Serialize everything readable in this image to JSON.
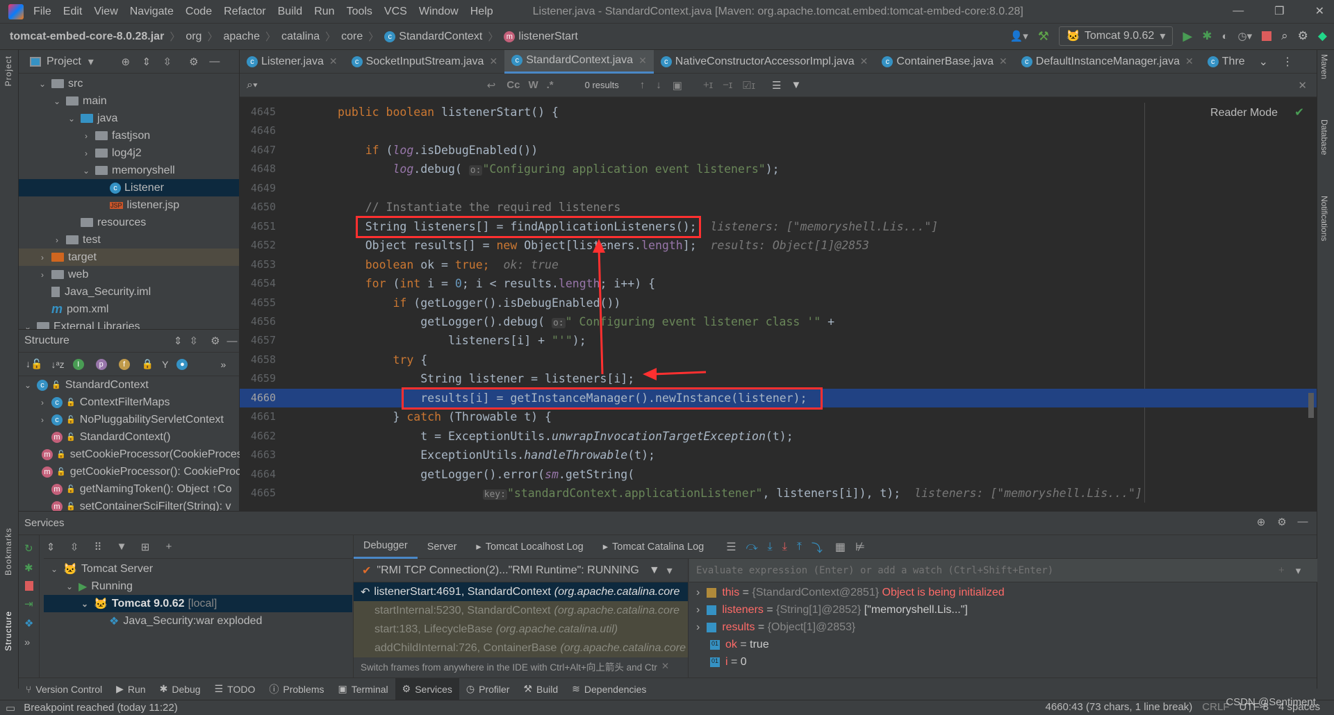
{
  "titlebar": {
    "menu": [
      "File",
      "Edit",
      "View",
      "Navigate",
      "Code",
      "Refactor",
      "Build",
      "Run",
      "Tools",
      "VCS",
      "Window",
      "Help"
    ],
    "title": "Listener.java - StandardContext.java [Maven: org.apache.tomcat.embed:tomcat-embed-core:8.0.28]"
  },
  "breadcrumb": [
    "tomcat-embed-core-8.0.28.jar",
    "org",
    "apache",
    "catalina",
    "core",
    "StandardContext",
    "listenerStart"
  ],
  "run_config": "Tomcat 9.0.62",
  "project": {
    "title": "Project",
    "tree": [
      {
        "label": "src",
        "depth": 1,
        "chev": "v",
        "icon": "folder"
      },
      {
        "label": "main",
        "depth": 2,
        "chev": "v",
        "icon": "folder"
      },
      {
        "label": "java",
        "depth": 3,
        "chev": "v",
        "icon": "source-folder"
      },
      {
        "label": "fastjson",
        "depth": 4,
        "chev": ">",
        "icon": "package"
      },
      {
        "label": "log4j2",
        "depth": 4,
        "chev": ">",
        "icon": "package"
      },
      {
        "label": "memoryshell",
        "depth": 4,
        "chev": "v",
        "icon": "package"
      },
      {
        "label": "Listener",
        "depth": 5,
        "chev": "",
        "icon": "class",
        "selected": true
      },
      {
        "label": "listener.jsp",
        "depth": 5,
        "chev": "",
        "icon": "jsp"
      },
      {
        "label": "resources",
        "depth": 3,
        "chev": "",
        "icon": "resources"
      },
      {
        "label": "test",
        "depth": 2,
        "chev": ">",
        "icon": "folder"
      },
      {
        "label": "target",
        "depth": 1,
        "chev": ">",
        "icon": "excluded-folder",
        "highlight": true
      },
      {
        "label": "web",
        "depth": 1,
        "chev": ">",
        "icon": "folder"
      },
      {
        "label": "Java_Security.iml",
        "depth": 1,
        "chev": "",
        "icon": "iml"
      },
      {
        "label": "pom.xml",
        "depth": 1,
        "chev": "",
        "icon": "maven"
      },
      {
        "label": "External Libraries",
        "depth": 0,
        "chev": "v",
        "icon": "libraries"
      }
    ]
  },
  "structure": {
    "title": "Structure",
    "items": [
      {
        "label": "StandardContext",
        "depth": 0,
        "chev": "v",
        "icon": "class"
      },
      {
        "label": "ContextFilterMaps",
        "depth": 1,
        "chev": ">",
        "icon": "class"
      },
      {
        "label": "NoPluggabilityServletContext",
        "depth": 1,
        "chev": ">",
        "icon": "class"
      },
      {
        "label": "StandardContext()",
        "depth": 1,
        "chev": "",
        "icon": "method"
      },
      {
        "label": "setCookieProcessor(CookieProcessor",
        "depth": 1,
        "chev": "",
        "icon": "method"
      },
      {
        "label": "getCookieProcessor(): CookieProcessor",
        "depth": 1,
        "chev": "",
        "icon": "method"
      },
      {
        "label": "getNamingToken(): Object ↑Co",
        "depth": 1,
        "chev": "",
        "icon": "method"
      },
      {
        "label": "setContainerSciFilter(String): v",
        "depth": 1,
        "chev": "",
        "icon": "method"
      }
    ]
  },
  "tabs": [
    {
      "label": "Listener.java"
    },
    {
      "label": "SocketInputStream.java"
    },
    {
      "label": "StandardContext.java",
      "active": true
    },
    {
      "label": "NativeConstructorAccessorImpl.java"
    },
    {
      "label": "ContainerBase.java"
    },
    {
      "label": "DefaultInstanceManager.java"
    },
    {
      "label": "Thre"
    }
  ],
  "findbar": {
    "results": "0 results",
    "options": [
      "Cc",
      "W",
      ".*"
    ]
  },
  "reader_mode": "Reader Mode",
  "current_line": 4660,
  "code": [
    {
      "n": 4645,
      "t": [
        [
          "kw",
          "public boolean "
        ],
        [
          "",
          "listenerStart() {"
        ]
      ]
    },
    {
      "n": 4646,
      "t": []
    },
    {
      "n": 4647,
      "t": [
        [
          "",
          "    "
        ],
        [
          "kw",
          "if"
        ],
        [
          "",
          " ("
        ],
        [
          "fldi",
          "log"
        ],
        [
          "",
          ".isDebugEnabled())"
        ]
      ]
    },
    {
      "n": 4648,
      "t": [
        [
          "",
          "        "
        ],
        [
          "fldi",
          "log"
        ],
        [
          "",
          ".debug( "
        ],
        [
          "hint",
          "o:"
        ],
        [
          "str",
          "\"Configuring application event listeners\""
        ],
        [
          "",
          ");"
        ]
      ]
    },
    {
      "n": 4649,
      "t": []
    },
    {
      "n": 4650,
      "t": [
        [
          "",
          "    "
        ],
        [
          "cm",
          "// Instantiate the required listeners"
        ]
      ]
    },
    {
      "n": 4651,
      "t": [
        [
          "",
          "    String listeners[] = findApplicationListeners();"
        ],
        [
          "inl",
          "  listeners: [\"memoryshell.Lis...\"]"
        ]
      ]
    },
    {
      "n": 4652,
      "t": [
        [
          "",
          "    Object results[] = "
        ],
        [
          "kw",
          "new"
        ],
        [
          "",
          " Object[listeners."
        ],
        [
          "fld",
          "length"
        ],
        [
          "",
          "];"
        ],
        [
          "inl",
          "  results: Object[1]@2853"
        ]
      ]
    },
    {
      "n": 4653,
      "t": [
        [
          "",
          "    "
        ],
        [
          "kw",
          "boolean "
        ],
        [
          "",
          "ok = "
        ],
        [
          "kw",
          "true;"
        ],
        [
          "inl",
          "  ok: true"
        ]
      ]
    },
    {
      "n": 4654,
      "t": [
        [
          "",
          "    "
        ],
        [
          "kw",
          "for"
        ],
        [
          "",
          " ("
        ],
        [
          "kw",
          "int"
        ],
        [
          "",
          " i = "
        ],
        [
          "num",
          "0"
        ],
        [
          "",
          "; i < results."
        ],
        [
          "fld",
          "length"
        ],
        [
          "",
          "; i++) {"
        ]
      ]
    },
    {
      "n": 4655,
      "t": [
        [
          "",
          "        "
        ],
        [
          "kw",
          "if"
        ],
        [
          "",
          " (getLogger().isDebugEnabled())"
        ]
      ]
    },
    {
      "n": 4656,
      "t": [
        [
          "",
          "            getLogger().debug( "
        ],
        [
          "hint",
          "o:"
        ],
        [
          "str",
          "\" Configuring event listener class '\""
        ],
        [
          "",
          " +"
        ]
      ]
    },
    {
      "n": 4657,
      "t": [
        [
          "",
          "                listeners[i] + "
        ],
        [
          "str",
          "\"'\""
        ],
        [
          "",
          ");"
        ]
      ]
    },
    {
      "n": 4658,
      "t": [
        [
          "",
          "        "
        ],
        [
          "kw",
          "try"
        ],
        [
          "",
          " {"
        ]
      ]
    },
    {
      "n": 4659,
      "t": [
        [
          "",
          "            String listener = listeners[i];"
        ]
      ]
    },
    {
      "n": 4660,
      "t": [
        [
          "",
          "            results[i] = getInstanceManager().newInstance(listener);"
        ]
      ]
    },
    {
      "n": 4661,
      "t": [
        [
          "",
          "        } "
        ],
        [
          "kw",
          "catch"
        ],
        [
          "",
          " (Throwable t) {"
        ]
      ]
    },
    {
      "n": 4662,
      "t": [
        [
          "",
          "            t = ExceptionUtils."
        ],
        [
          "it",
          "unwrapInvocationTargetException"
        ],
        [
          "",
          "(t);"
        ]
      ]
    },
    {
      "n": 4663,
      "t": [
        [
          "",
          "            ExceptionUtils."
        ],
        [
          "it",
          "handleThrowable"
        ],
        [
          "",
          "(t);"
        ]
      ]
    },
    {
      "n": 4664,
      "t": [
        [
          "",
          "            getLogger().error("
        ],
        [
          "fldi",
          "sm"
        ],
        [
          "",
          ".getString("
        ]
      ]
    },
    {
      "n": 4665,
      "t": [
        [
          "",
          "                     "
        ],
        [
          "hint",
          "key:"
        ],
        [
          "str",
          "\"standardContext.applicationListener\""
        ],
        [
          "",
          ", listeners[i]), t);"
        ],
        [
          "inl",
          "  listeners: [\"memoryshell.Lis...\"]"
        ]
      ]
    }
  ],
  "annotation_color": "#ff3030",
  "services": {
    "title": "Services",
    "tree": [
      {
        "label": "Tomcat Server",
        "depth": 0
      },
      {
        "label": "Running",
        "depth": 1
      },
      {
        "label": "Tomcat 9.0.62",
        "suffix": "[local]",
        "depth": 2,
        "selected": true
      },
      {
        "label": "Java_Security:war exploded",
        "depth": 3
      }
    ]
  },
  "debugger": {
    "tabs": [
      "Debugger",
      "Server",
      "Tomcat Localhost Log",
      "Tomcat Catalina Log"
    ],
    "thread": "\"RMI TCP Connection(2)...\"RMI Runtime\": RUNNING",
    "frames": [
      {
        "method": "listenerStart:4691, StandardContext",
        "pkg": "(org.apache.catalina.core"
      },
      {
        "method": "startInternal:5230, StandardContext",
        "pkg": "(org.apache.catalina.core"
      },
      {
        "method": "start:183, LifecycleBase",
        "pkg": "(org.apache.catalina.util)"
      },
      {
        "method": "addChildInternal:726, ContainerBase",
        "pkg": "(org.apache.catalina.core"
      }
    ],
    "frames_hint": "Switch frames from anywhere in the IDE with Ctrl+Alt+向上箭头 and Ctr",
    "eval_placeholder": "Evaluate expression (Enter) or add a watch (Ctrl+Shift+Enter)",
    "variables": [
      {
        "name": "this",
        "eq": " = ",
        "ref": "{StandardContext@2851}",
        "value": " Object is being initialized",
        "warn": true,
        "expand": true
      },
      {
        "name": "listeners",
        "eq": " = ",
        "ref": "{String[1]@2852}",
        "value": " [\"memoryshell.Lis...\"]",
        "expand": true
      },
      {
        "name": "results",
        "eq": " = ",
        "ref": "{Object[1]@2853}",
        "value": "",
        "expand": true
      },
      {
        "name": "ok",
        "eq": " = ",
        "ref": "",
        "value": "true"
      },
      {
        "name": "i",
        "eq": " = ",
        "ref": "",
        "value": "0"
      }
    ]
  },
  "bottom_tabs": [
    {
      "label": "Version Control"
    },
    {
      "label": "Run"
    },
    {
      "label": "Debug"
    },
    {
      "label": "TODO"
    },
    {
      "label": "Problems"
    },
    {
      "label": "Terminal"
    },
    {
      "label": "Services",
      "active": true
    },
    {
      "label": "Profiler"
    },
    {
      "label": "Build"
    },
    {
      "label": "Dependencies"
    }
  ],
  "left_strip": [
    "Project",
    "Bookmarks",
    "Structure"
  ],
  "right_strip": [
    "Maven",
    "Database",
    "Notifications"
  ],
  "status": {
    "message": "Breakpoint reached (today 11:22)",
    "position": "4660:43 (73 chars, 1 line break)",
    "line_sep": "CRLF",
    "encoding": "UTF-8",
    "indent": "4 spaces",
    "watermark": "CSDN @Sentiment."
  }
}
